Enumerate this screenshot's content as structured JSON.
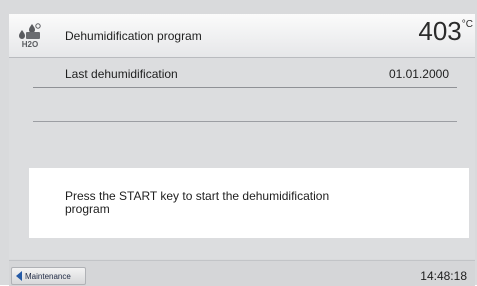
{
  "header": {
    "icon": "water-drop-h2o-icon",
    "icon_text": "H2O",
    "title": "Dehumidification program",
    "temperature": "403",
    "temperature_unit": "°C"
  },
  "content": {
    "last_label": "Last dehumidification",
    "last_value": "01.01.2000",
    "message": "Press the START key to start the dehumidification program"
  },
  "footer": {
    "back_label": "Maintenance",
    "back_icon": "left-arrow-icon",
    "time": "14:48:18"
  },
  "colors": {
    "accent": "#245aa6",
    "background": "#d9dadc"
  }
}
